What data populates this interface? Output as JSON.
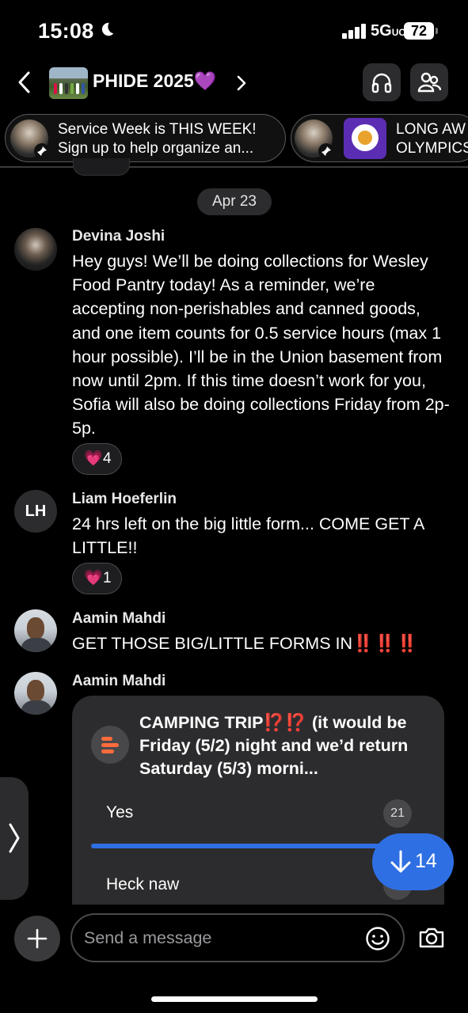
{
  "status_bar": {
    "time": "15:08",
    "network": "5G",
    "network_suffix": "UC",
    "battery": "72"
  },
  "header": {
    "title": "PHIDE 2025",
    "title_emoji": "💜"
  },
  "pinned": [
    {
      "text_line1": "Service Week is THIS WEEK!",
      "text_line2": "Sign up to help organize an..."
    },
    {
      "text_line1": "LONG AW",
      "text_line2": "OLYMPICS"
    }
  ],
  "date_separator": "Apr 23",
  "messages": [
    {
      "sender": "Devina Joshi",
      "text": "Hey guys! We’ll be doing collections for Wesley Food Pantry today! As a reminder, we’re accepting non-perishables and canned goods, and one item counts for 0.5 service hours (max 1 hour possible). I’ll be in the Union basement from now until 2pm. If this time doesn’t work for you, Sofia will also be doing collections Friday from 2p-5p.",
      "reaction_emoji": "💗",
      "reaction_count": "4"
    },
    {
      "sender": "Liam Hoeferlin",
      "initials": "LH",
      "text": "24 hrs left on the big little form... COME GET A LITTLE!!",
      "reaction_emoji": "💗",
      "reaction_count": "1"
    },
    {
      "sender": "Aamin Mahdi",
      "text": "GET THOSE BIG/LITTLE FORMS IN",
      "emphasis": "‼️‼️‼️"
    },
    {
      "sender": "Aamin Mahdi",
      "poll": {
        "question_prefix": "CAMPING TRIP",
        "question_emoji": "⁉️⁉️",
        "question_rest": " (it would be Friday (5/2) night and we’d return Saturday (5/3) morni...",
        "options": [
          {
            "label": "Yes",
            "count": "21",
            "fill": 0.9
          },
          {
            "label": "Heck naw"
          }
        ]
      }
    }
  ],
  "jump_button": {
    "count": "14"
  },
  "composer": {
    "placeholder": "Send a message"
  },
  "colors": {
    "accent": "#2f6fe4",
    "poll_icon": "#ff6b3d",
    "reaction_border": "#4a4a4e"
  }
}
